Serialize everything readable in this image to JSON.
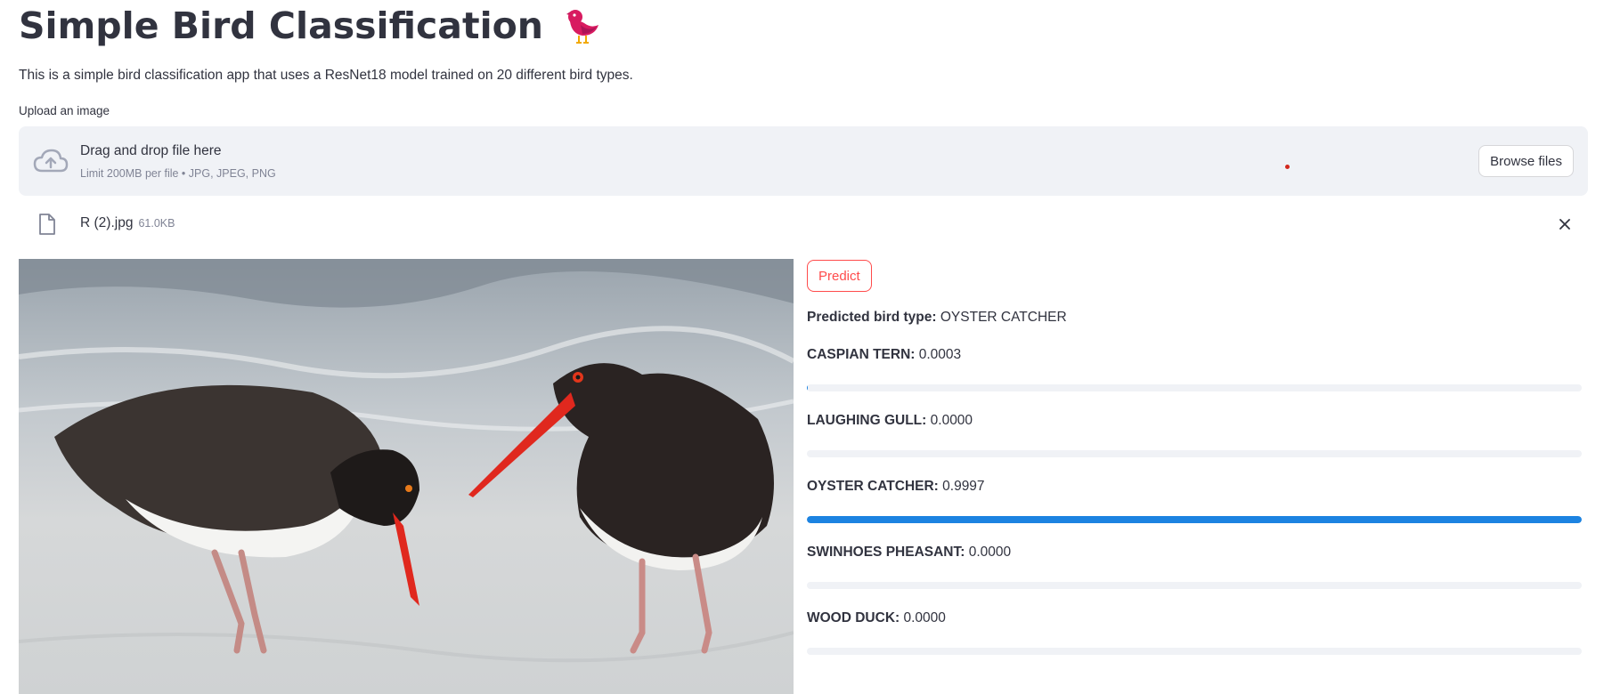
{
  "header": {
    "title": "Simple Bird Classification",
    "icon": "red-bird-icon",
    "description": "This is a simple bird classification app that uses a ResNet18 model trained on 20 different bird types."
  },
  "uploader": {
    "label": "Upload an image",
    "drop_title": "Drag and drop file here",
    "drop_limit": "Limit 200MB per file • JPG, JPEG, PNG",
    "browse_label": "Browse files"
  },
  "file": {
    "name": "R (2).jpg",
    "size": "61.0KB"
  },
  "image": {
    "description": "two oystercatcher birds on a beach"
  },
  "predict_label": "Predict",
  "prediction": {
    "label": "Predicted bird type:",
    "value": "OYSTER CATCHER"
  },
  "results": [
    {
      "name": "CASPIAN TERN:",
      "score": "0.0003",
      "fraction": 0.0003
    },
    {
      "name": "LAUGHING GULL:",
      "score": "0.0000",
      "fraction": 0.0
    },
    {
      "name": "OYSTER CATCHER:",
      "score": "0.9997",
      "fraction": 0.9997
    },
    {
      "name": "SWINHOES PHEASANT:",
      "score": "0.0000",
      "fraction": 0.0
    },
    {
      "name": "WOOD DUCK:",
      "score": "0.0000",
      "fraction": 0.0
    }
  ],
  "colors": {
    "accent": "#ff4b4b",
    "progress": "#1c83e1",
    "track": "#f0f2f6",
    "text": "#31333f"
  }
}
